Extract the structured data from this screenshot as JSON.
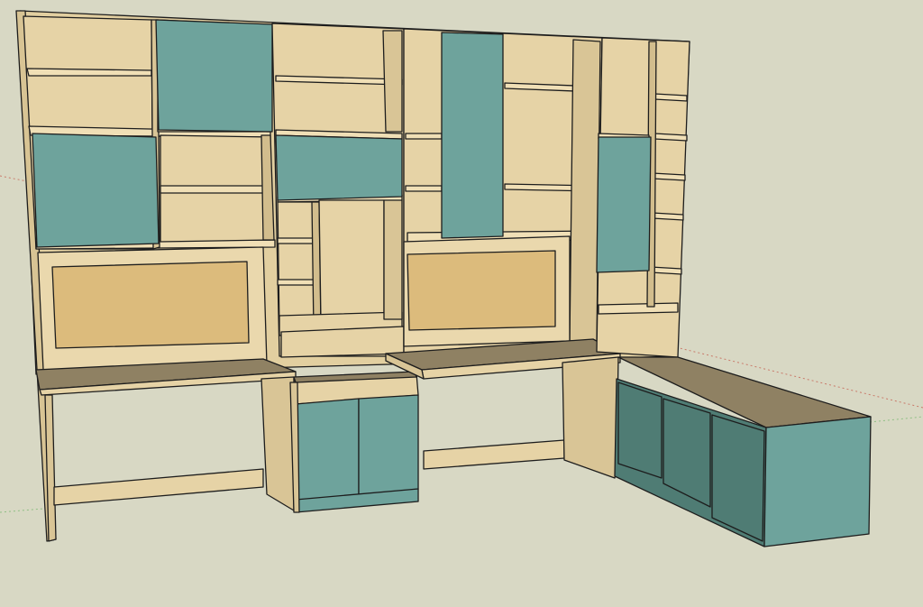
{
  "colors": {
    "background": "#d8d8c4",
    "plywood": "#e6d3a6",
    "plywood_shadow": "#c6b383",
    "plywood_top": "#8f8163",
    "panel_teal": "#6ea39c",
    "panel_teal_shadow": "#4f7c74",
    "cork": "#dcbb7c",
    "axis_red": "#c97a6a",
    "axis_green": "#8fbf84"
  },
  "scene": {
    "description_label": "",
    "icons": [
      "bookcase-wall",
      "desk",
      "corkboard",
      "cabinet-door",
      "storage-bench"
    ]
  }
}
